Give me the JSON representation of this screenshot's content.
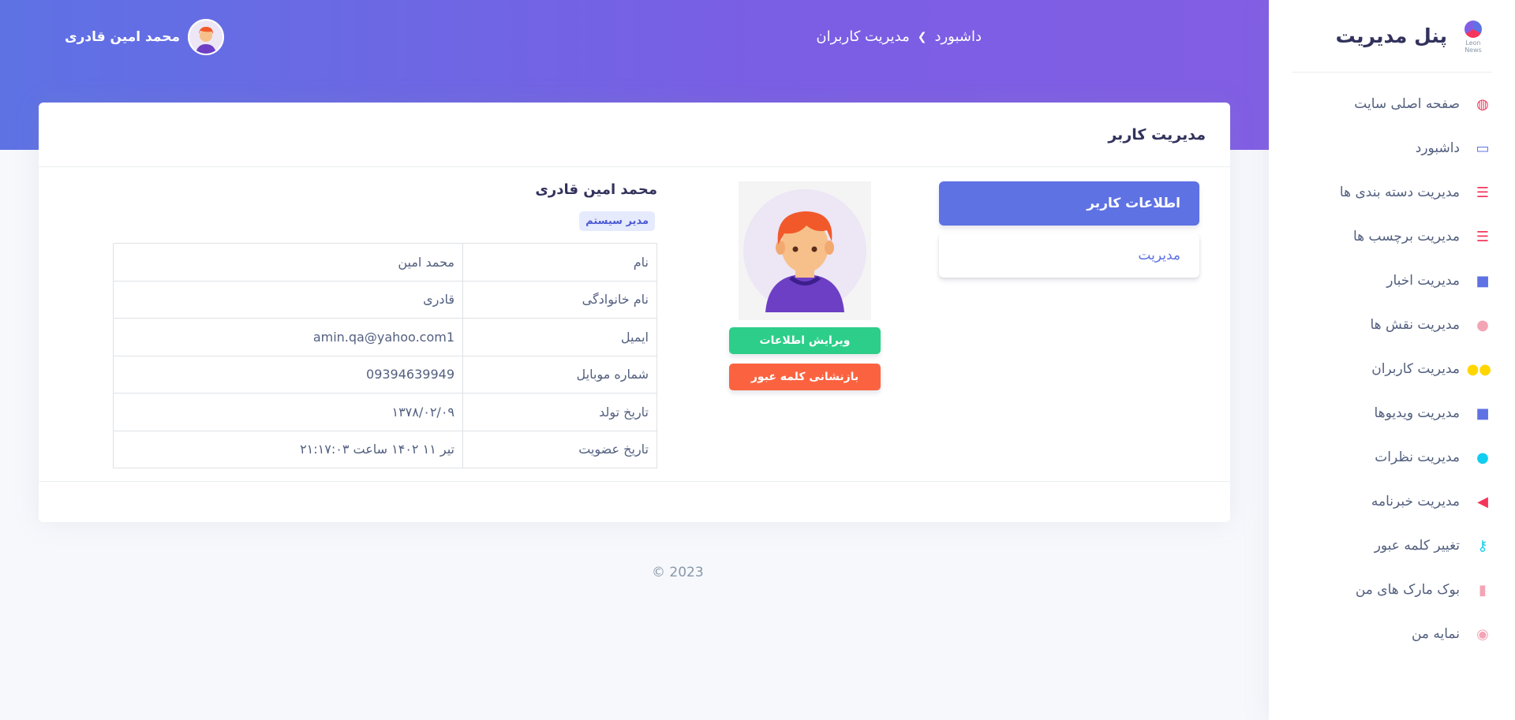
{
  "header": {
    "breadcrumb": [
      "داشبورد",
      "مدیریت کاربران"
    ],
    "user_name": "محمد امین قادری"
  },
  "sidebar": {
    "brand_title": "پنل مدیریت",
    "brand_sub": "Leon News",
    "items": [
      {
        "label": "صفحه اصلی سایت",
        "icon": "home-icon",
        "color": "#f5365c"
      },
      {
        "label": "داشبورد",
        "icon": "monitor-icon",
        "color": "#5e72e4"
      },
      {
        "label": "مدیریت دسته بندی ها",
        "icon": "list-icon",
        "color": "#f5365c"
      },
      {
        "label": "مدیریت برچسب ها",
        "icon": "list-icon",
        "color": "#f5365c"
      },
      {
        "label": "مدیریت اخبار",
        "icon": "folder-icon",
        "color": "#5e72e4"
      },
      {
        "label": "مدیریت نقش ها",
        "icon": "user-icon",
        "color": "#f3a4b5"
      },
      {
        "label": "مدیریت کاربران",
        "icon": "users-icon",
        "color": "#ffd600"
      },
      {
        "label": "مدیریت ویدیوها",
        "icon": "video-icon",
        "color": "#5e72e4"
      },
      {
        "label": "مدیریت نظرات",
        "icon": "comments-icon",
        "color": "#11cdef"
      },
      {
        "label": "مدیریت خبرنامه",
        "icon": "megaphone-icon",
        "color": "#f5365c"
      },
      {
        "label": "تغییر کلمه عبور",
        "icon": "key-icon",
        "color": "#11cdef"
      },
      {
        "label": "بوک مارک های من",
        "icon": "bookmark-icon",
        "color": "#f3a4b5"
      },
      {
        "label": "نمایه من",
        "icon": "profile-icon",
        "color": "#f3a4b5"
      }
    ]
  },
  "card": {
    "title": "مدیریت کاربر",
    "tabs": [
      "اطلاعات کاربر",
      "مدیریت"
    ],
    "buttons": {
      "edit": "ویرایش اطلاعات",
      "reset": "بازنشانی کلمه عبور"
    },
    "user_name": "محمد امین قادری",
    "role": "مدیر سیستم",
    "rows": [
      {
        "label": "نام",
        "value": "محمد امین"
      },
      {
        "label": "نام خانوادگی",
        "value": "قادری"
      },
      {
        "label": "ایمیل",
        "value": "amin.qa@yahoo.com1"
      },
      {
        "label": "شماره موبایل",
        "value": "09394639949"
      },
      {
        "label": "تاریخ تولد",
        "value": "۱۳۷۸/۰۲/۰۹"
      },
      {
        "label": "تاریخ عضویت",
        "value": "تیر ۱۱ ۱۴۰۲ ساعت ۲۱:۱۷:۰۳"
      }
    ]
  },
  "footer": {
    "copyright": "© 2023"
  },
  "colors": {
    "primary": "#5e72e4",
    "success": "#2dce89",
    "warning": "#fb6340"
  }
}
